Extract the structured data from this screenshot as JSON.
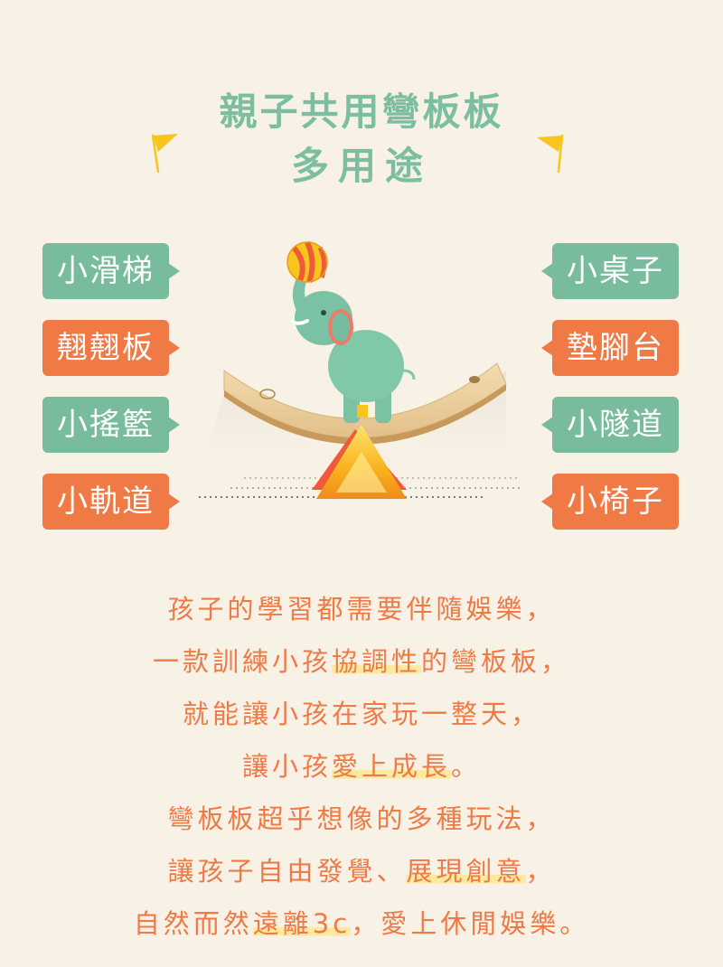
{
  "title": {
    "line1": "親子共用彎板板",
    "line2": "多用途"
  },
  "colors": {
    "background": "#f7f1e6",
    "green": "#78bb9d",
    "orange": "#ef7a46",
    "title_green": "#7bbfa0",
    "flag_yellow": "#f7c51e",
    "highlight": "#fde9a0"
  },
  "left_tags": [
    {
      "label": "小滑梯",
      "color": "green"
    },
    {
      "label": "翹翹板",
      "color": "orange"
    },
    {
      "label": "小搖籃",
      "color": "green"
    },
    {
      "label": "小軌道",
      "color": "orange"
    }
  ],
  "right_tags": [
    {
      "label": "小桌子",
      "color": "green"
    },
    {
      "label": "墊腳台",
      "color": "orange"
    },
    {
      "label": "小隧道",
      "color": "green"
    },
    {
      "label": "小椅子",
      "color": "orange"
    }
  ],
  "illustration": {
    "icons": [
      "circus-ball-icon",
      "elephant-icon",
      "curved-board-icon",
      "triangle-fulcrum-icon",
      "flag-icon"
    ]
  },
  "body": {
    "line1": "孩子的學習都需要伴隨娛樂，",
    "line2_a": "一款訓練小孩",
    "line2_hl": "協調性",
    "line2_b": "的彎板板，",
    "line3": "就能讓小孩在家玩一整天，",
    "line4_a": "讓小孩",
    "line4_hl": "愛上成長",
    "line4_b": "。",
    "line5": "彎板板超乎想像的多種玩法，",
    "line6_a": "讓孩子自由發覺、",
    "line6_hl": "展現創意",
    "line6_b": "，",
    "line7_a": "自然而然",
    "line7_hl": "遠離3c",
    "line7_b": "，愛上休閒娛樂。"
  }
}
